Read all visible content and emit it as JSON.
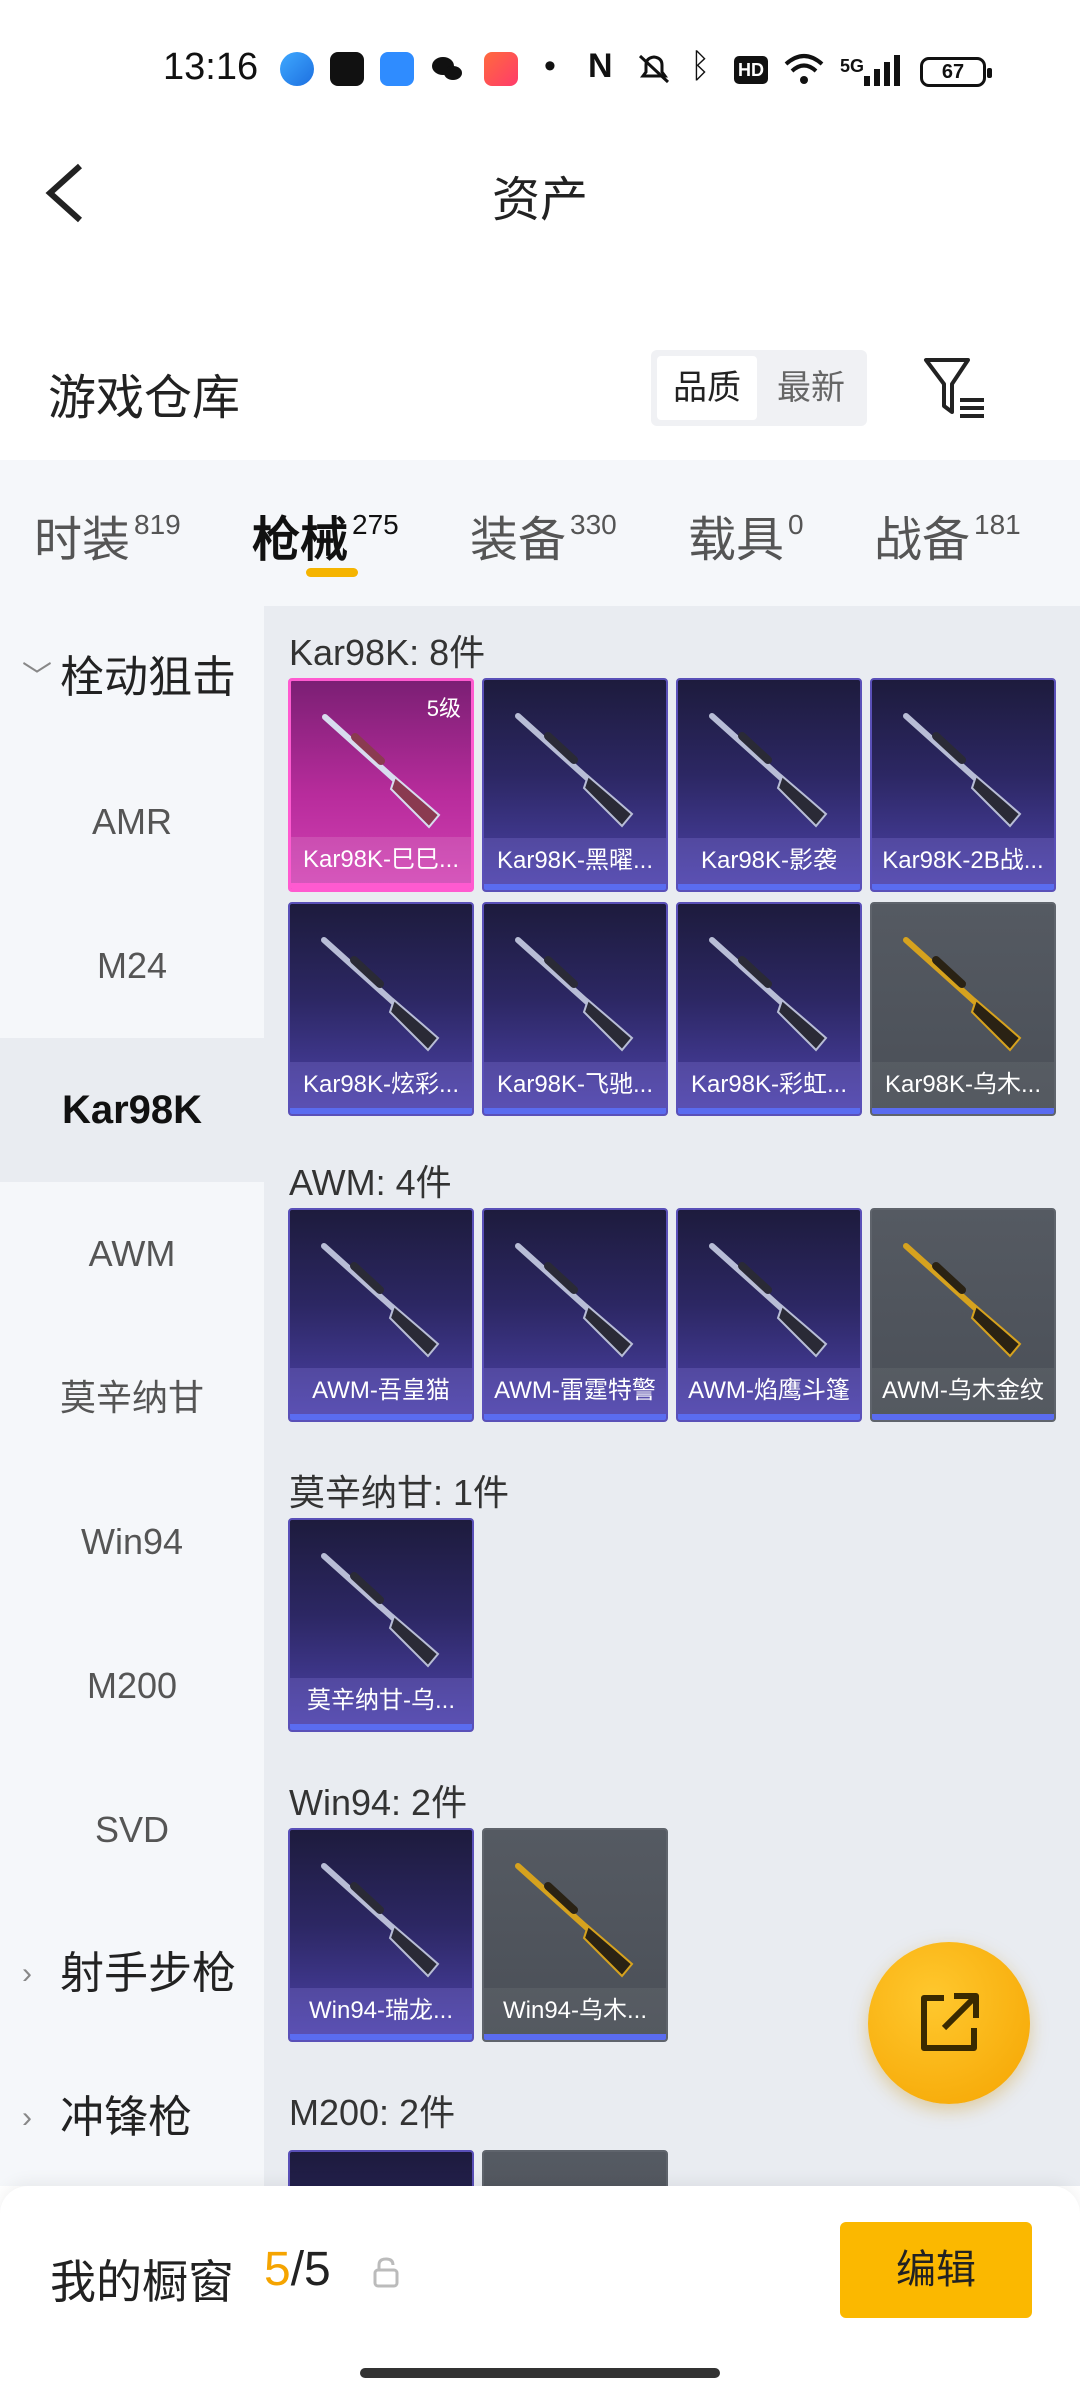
{
  "status_bar": {
    "time": "13:16",
    "network": "5G",
    "battery": "67",
    "icons": [
      "maps-icon",
      "tiktok-icon",
      "app-icon",
      "wechat-icon",
      "game-icon",
      "dot-icon",
      "nfc-icon",
      "mute-icon",
      "bluetooth-icon",
      "hd-icon",
      "wifi-icon",
      "signal-icon",
      "battery-icon"
    ]
  },
  "header": {
    "title": "资产"
  },
  "warehouse": {
    "title": "游戏仓库",
    "sort_quality": "品质",
    "sort_newest": "最新"
  },
  "tabs": [
    {
      "label": "时装",
      "count": "819"
    },
    {
      "label": "枪械",
      "count": "275",
      "active": true
    },
    {
      "label": "装备",
      "count": "330"
    },
    {
      "label": "载具",
      "count": "0"
    },
    {
      "label": "战备",
      "count": "181"
    }
  ],
  "sidebar": {
    "group_bolt": "栓动狙击",
    "items": [
      "AMR",
      "M24",
      "Kar98K",
      "AWM",
      "莫辛纳甘",
      "Win94",
      "M200",
      "SVD"
    ],
    "active": "Kar98K",
    "group_marksman": "射手步枪",
    "group_smg": "冲锋枪"
  },
  "groups": [
    {
      "title": "Kar98K: 8件",
      "items": [
        {
          "name": "Kar98K-巳巳...",
          "style": "pink",
          "level": "5级"
        },
        {
          "name": "Kar98K-黑曜...",
          "style": "purple"
        },
        {
          "name": "Kar98K-影袭",
          "style": "purple"
        },
        {
          "name": "Kar98K-2B战...",
          "style": "purple"
        },
        {
          "name": "Kar98K-炫彩...",
          "style": "purple"
        },
        {
          "name": "Kar98K-飞驰...",
          "style": "purple"
        },
        {
          "name": "Kar98K-彩虹...",
          "style": "purple"
        },
        {
          "name": "Kar98K-乌木...",
          "style": "gold"
        }
      ]
    },
    {
      "title": "AWM: 4件",
      "items": [
        {
          "name": "AWM-吾皇猫",
          "style": "purple"
        },
        {
          "name": "AWM-雷霆特警",
          "style": "purple"
        },
        {
          "name": "AWM-焰鹰斗篷",
          "style": "purple"
        },
        {
          "name": "AWM-乌木金纹",
          "style": "gold"
        }
      ]
    },
    {
      "title": "莫辛纳甘: 1件",
      "items": [
        {
          "name": "莫辛纳甘-乌...",
          "style": "purple"
        }
      ]
    },
    {
      "title": "Win94: 2件",
      "items": [
        {
          "name": "Win94-瑞龙...",
          "style": "purple"
        },
        {
          "name": "Win94-乌木...",
          "style": "gold"
        }
      ]
    },
    {
      "title": "M200: 2件",
      "items": []
    }
  ],
  "bottom": {
    "showcase_label": "我的橱窗",
    "showcase_current": "5",
    "showcase_sep": "/",
    "showcase_total": "5",
    "edit_label": "编辑"
  },
  "colors": {
    "accent": "#f5b400",
    "card_purple": "#4d43ab",
    "card_pink": "#d241b4",
    "card_gold": "#4a4f57"
  }
}
